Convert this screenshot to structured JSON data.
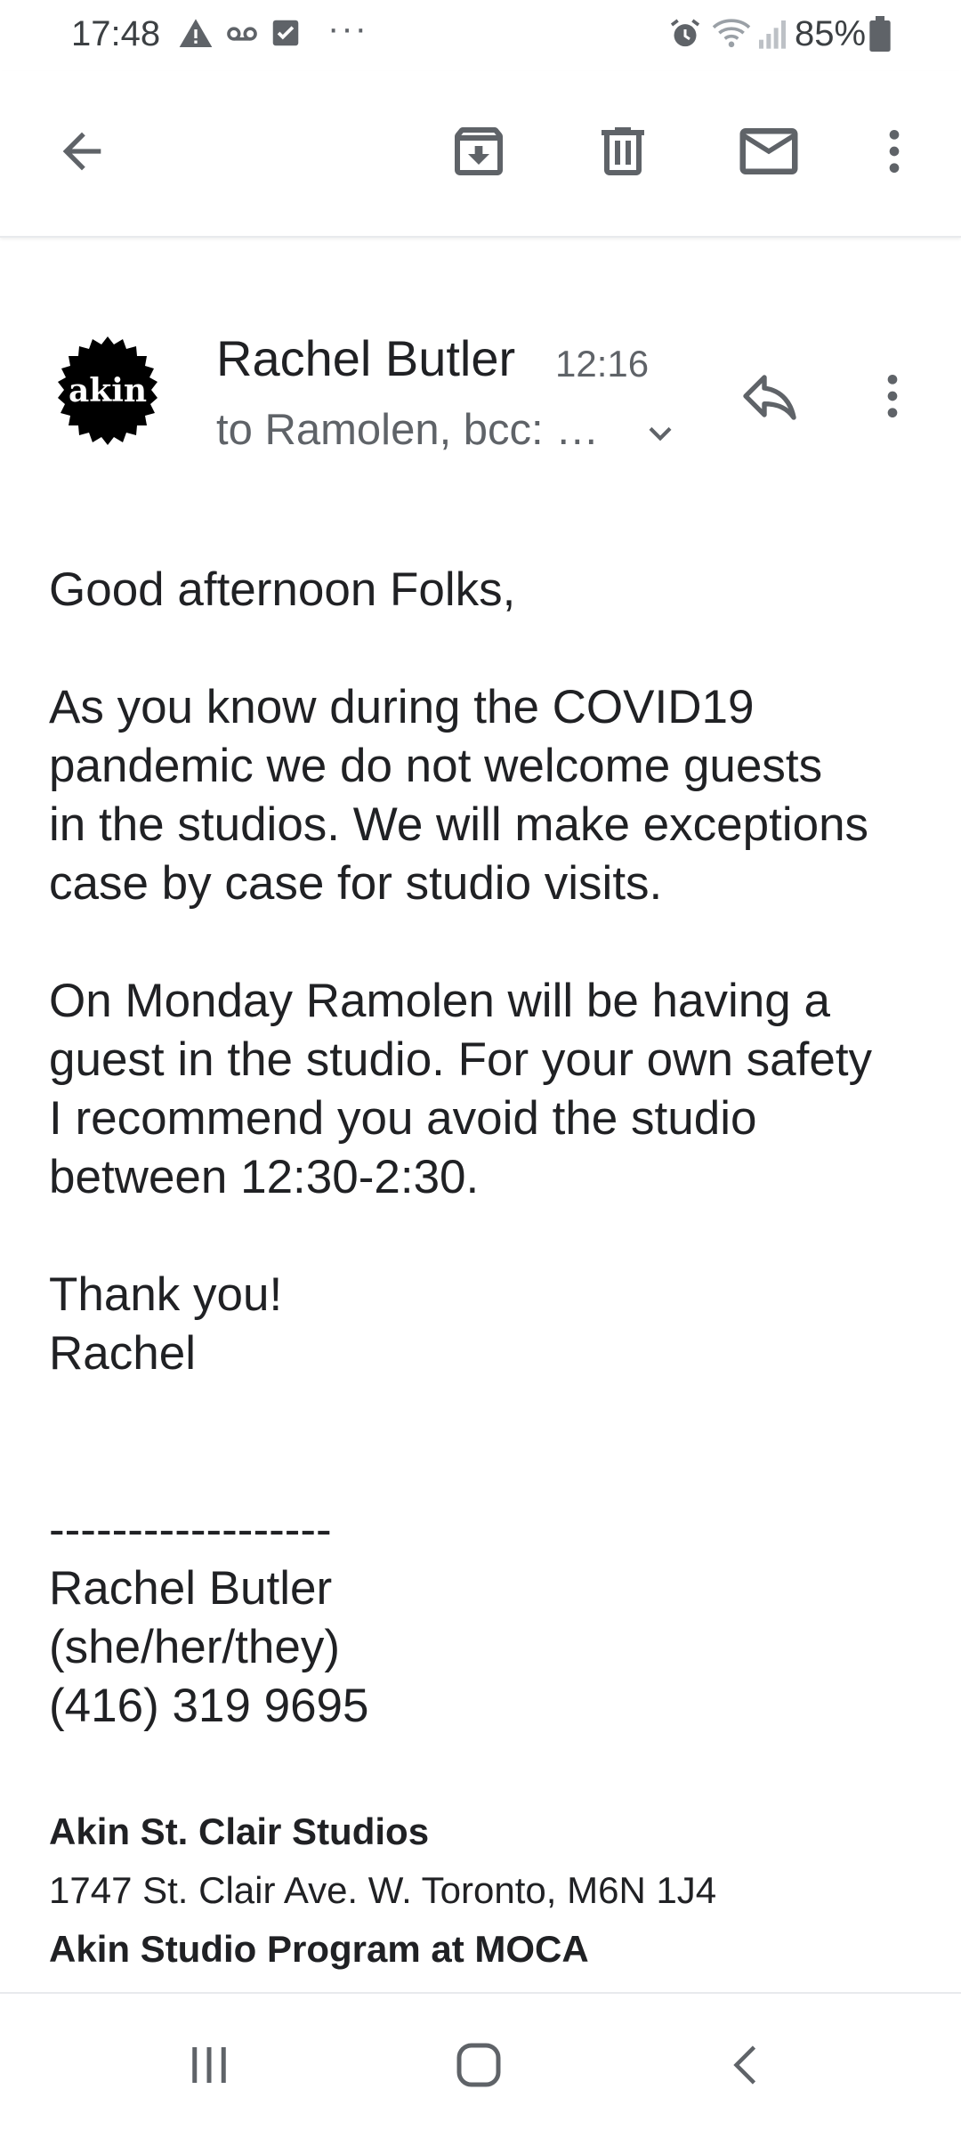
{
  "status_bar": {
    "time": "17:48",
    "dots": "···",
    "battery": "85%",
    "icons": [
      "warning-icon",
      "voicemail-icon",
      "checkbox-icon",
      "alarm-icon",
      "wifi-icon",
      "signal-icon",
      "battery-icon"
    ]
  },
  "toolbar": {
    "icons": [
      "back-arrow-icon",
      "archive-icon",
      "delete-icon",
      "mark-unread-icon",
      "more-vert-icon"
    ]
  },
  "message": {
    "avatar_text": "akin",
    "sender": "Rachel Butler",
    "time": "12:16",
    "recipients": "to Ramolen, bcc: …",
    "body": {
      "greeting": "Good afternoon Folks,",
      "para1": [
        "As you know during the COVID19",
        "pandemic we do not welcome guests",
        "in the studios. We will make exceptions",
        "case by case for studio visits."
      ],
      "para2": [
        "On Monday Ramolen will be having a",
        "guest in the studio. For your own safety",
        "I recommend you avoid the studio",
        "between 12:30-2:30."
      ],
      "closing": [
        "Thank you!",
        "Rachel"
      ]
    },
    "signature": {
      "divider": "------------------",
      "name": "Rachel Butler",
      "pronouns": "(she/her/they)",
      "phone": "(416) 319 9695",
      "org1": "Akin St. Clair Studios",
      "address": "1747 St. Clair Ave. W. Toronto, M6N 1J4",
      "org2": "Akin Studio Program at MOCA"
    }
  },
  "colors": {
    "icon": "#5f6368",
    "text": "#202124",
    "secondary_text": "#5f6368",
    "avatar_bg": "#000000"
  },
  "navbar": {
    "icons": [
      "recent-apps-icon",
      "home-icon",
      "back-icon"
    ]
  }
}
